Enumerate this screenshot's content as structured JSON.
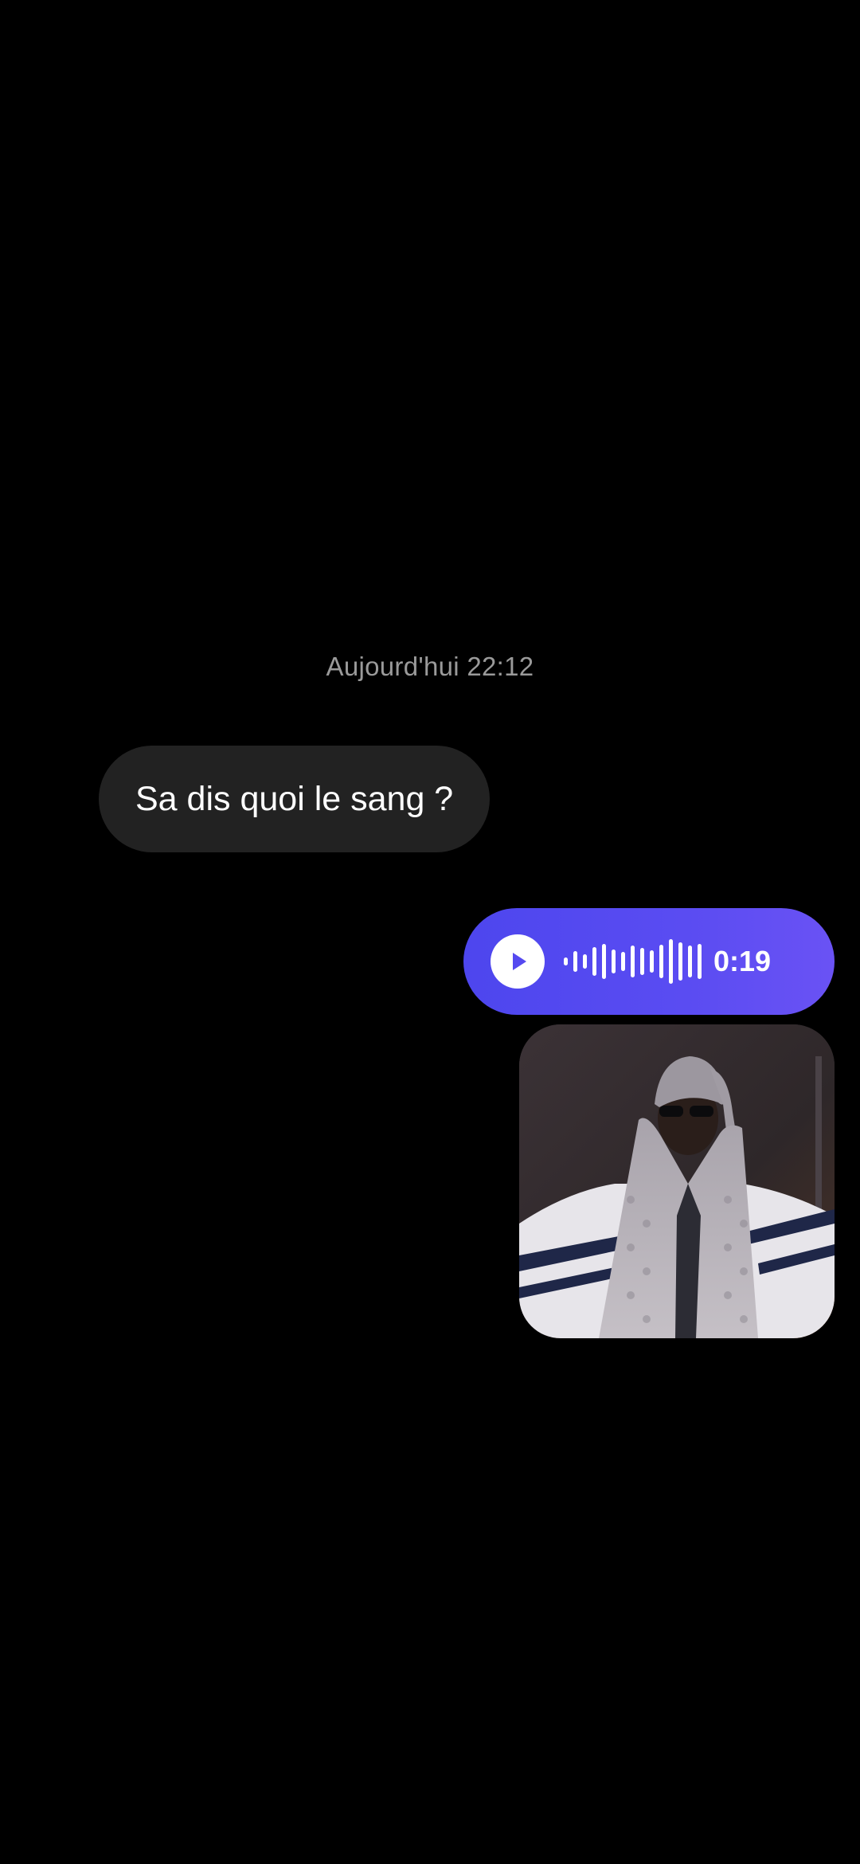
{
  "chat": {
    "timestamp": "Aujourd'hui 22:12",
    "incoming_message": "Sa dis quoi le sang ?",
    "voice_message": {
      "duration": "0:19",
      "play_icon": "play-icon"
    },
    "photo_message": {
      "icon": "photo-thumbnail"
    }
  },
  "colors": {
    "background": "#000000",
    "incoming_bubble": "#222222",
    "outgoing_bubble": "#5549f0",
    "timestamp_text": "#9a9a9a"
  }
}
